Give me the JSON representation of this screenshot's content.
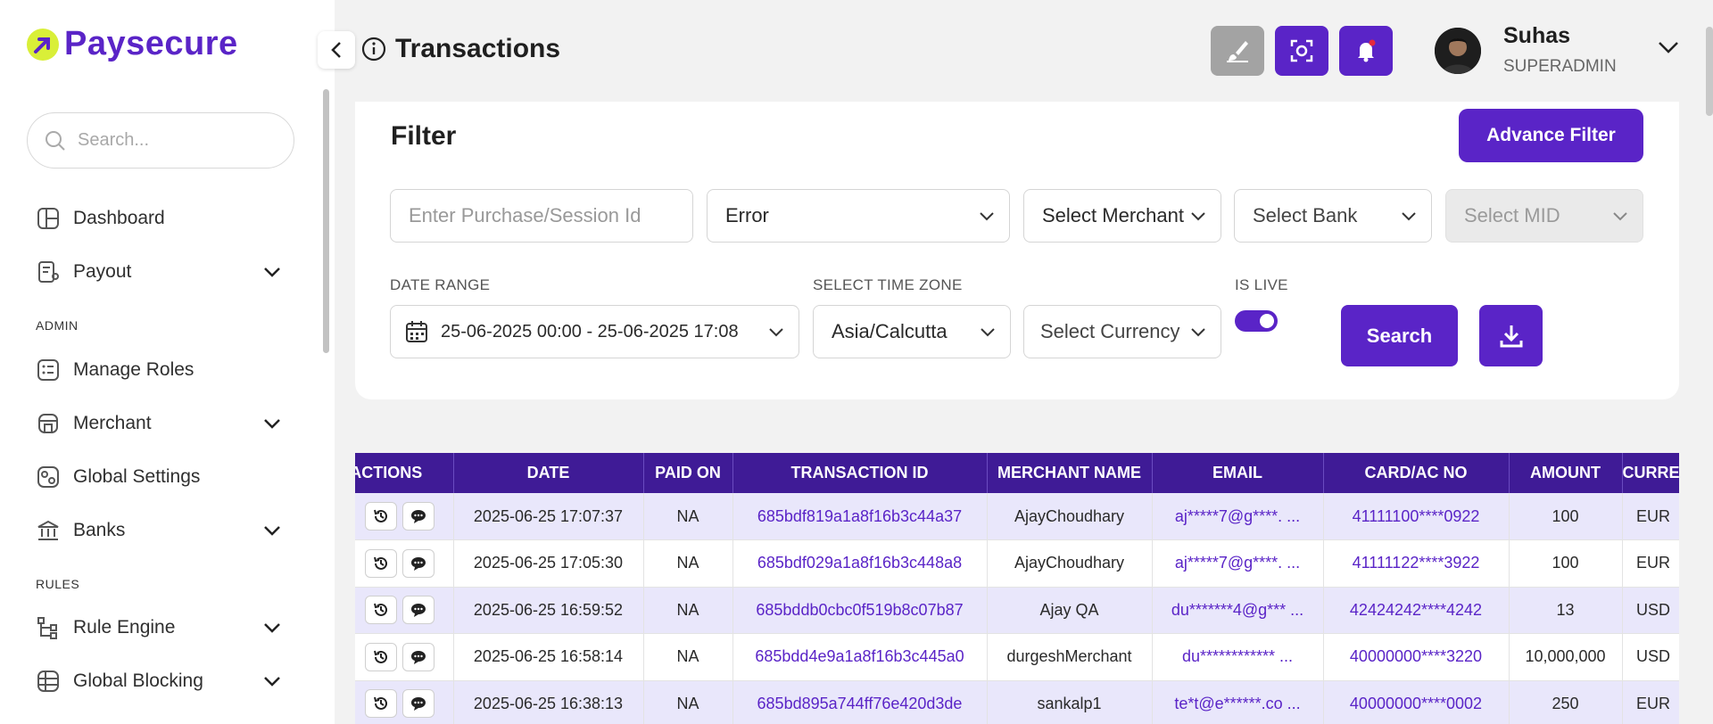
{
  "brand": {
    "name": "Paysecure",
    "accent": "#5a24c7",
    "logo_bg": "#d9ef38"
  },
  "sidebar": {
    "search_placeholder": "Search...",
    "items": [
      {
        "label": "Dashboard",
        "icon": "dashboard-icon"
      },
      {
        "label": "Payout",
        "icon": "payout-icon",
        "expandable": true
      },
      {
        "label": "Manage Roles",
        "icon": "roles-icon"
      },
      {
        "label": "Merchant",
        "icon": "merchant-icon",
        "expandable": true
      },
      {
        "label": "Global Settings",
        "icon": "settings-icon"
      },
      {
        "label": "Banks",
        "icon": "bank-icon",
        "expandable": true
      },
      {
        "label": "Rule Engine",
        "icon": "rule-engine-icon",
        "expandable": true
      },
      {
        "label": "Global Blocking",
        "icon": "global-blocking-icon",
        "expandable": true
      }
    ],
    "sections": {
      "admin": "ADMIN",
      "rules": "RULES"
    }
  },
  "header": {
    "title": "Transactions",
    "user": {
      "name": "Suhas",
      "role": "SUPERADMIN"
    }
  },
  "filter": {
    "title": "Filter",
    "advance_filter_label": "Advance Filter",
    "purchase_placeholder": "Enter Purchase/Session Id",
    "status_value": "Error",
    "merchant_placeholder": "Select Merchant",
    "bank_placeholder": "Select Bank",
    "mid_placeholder": "Select MID",
    "date_range_label": "DATE RANGE",
    "date_range_value": "25-06-2025 00:00 - 25-06-2025 17:08",
    "timezone_label": "SELECT TIME ZONE",
    "timezone_value": "Asia/Calcutta",
    "currency_placeholder": "Select Currency",
    "is_live_label": "IS LIVE",
    "is_live": true,
    "search_label": "Search"
  },
  "table": {
    "columns": [
      "ACTIONS",
      "DATE",
      "PAID ON",
      "TRANSACTION ID",
      "MERCHANT NAME",
      "EMAIL",
      "CARD/AC NO",
      "AMOUNT",
      "CURRENCY"
    ],
    "rows": [
      {
        "date": "2025-06-25 17:07:37",
        "paid_on": "NA",
        "txn_id": "685bdf819a1a8f16b3c44a37",
        "merchant": "AjayChoudhary",
        "email": "aj*****7@g****. ...",
        "card": "41111100****0922",
        "amount": "100",
        "currency": "EUR"
      },
      {
        "date": "2025-06-25 17:05:30",
        "paid_on": "NA",
        "txn_id": "685bdf029a1a8f16b3c448a8",
        "merchant": "AjayChoudhary",
        "email": "aj*****7@g****. ...",
        "card": "41111122****3922",
        "amount": "100",
        "currency": "EUR"
      },
      {
        "date": "2025-06-25 16:59:52",
        "paid_on": "NA",
        "txn_id": "685bddb0cbc0f519b8c07b87",
        "merchant": "Ajay QA",
        "email": "du*******4@g*** ...",
        "card": "42424242****4242",
        "amount": "13",
        "currency": "USD"
      },
      {
        "date": "2025-06-25 16:58:14",
        "paid_on": "NA",
        "txn_id": "685bdd4e9a1a8f16b3c445a0",
        "merchant": "durgeshMerchant",
        "email": "du************ ...",
        "card": "40000000****3220",
        "amount": "10,000,000",
        "currency": "USD"
      },
      {
        "date": "2025-06-25 16:38:13",
        "paid_on": "NA",
        "txn_id": "685bd895a744ff76e420d3de",
        "merchant": "sankalp1",
        "email": "te*t@e******.co ...",
        "card": "40000000****0002",
        "amount": "250",
        "currency": "EUR"
      }
    ]
  }
}
